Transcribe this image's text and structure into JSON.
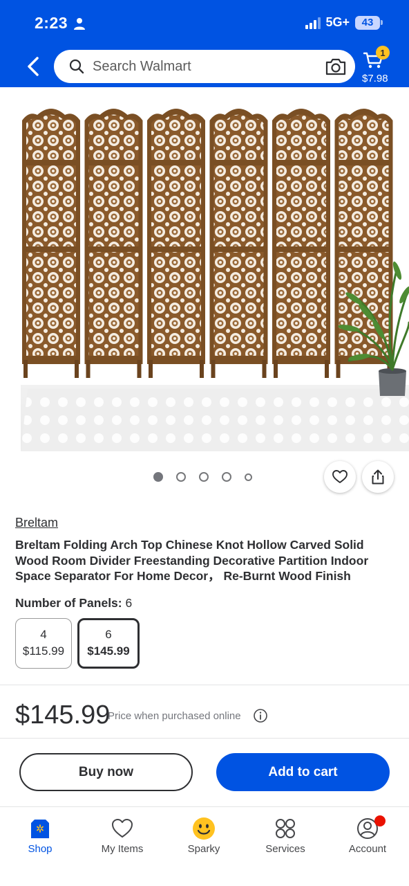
{
  "status_bar": {
    "time": "2:23",
    "network": "5G+",
    "battery": "43"
  },
  "header": {
    "search_placeholder": "Search Walmart",
    "cart_count": "1",
    "cart_total": "$7.98",
    "brand_color": "#0053e2"
  },
  "carousel": {
    "total_images": 5,
    "active_index": 0
  },
  "product": {
    "brand": "Breltam",
    "title": "Breltam Folding Arch Top Chinese Knot Hollow Carved Solid Wood Room Divider Freestanding Decorative Partition Indoor Space Separator For Home Decor，  Re-Burnt Wood Finish",
    "panels_label": "Number of Panels:",
    "panels_value": "6",
    "options": [
      {
        "panels": "4",
        "price": "$115.99"
      },
      {
        "panels": "6",
        "price": "$145.99"
      }
    ],
    "price": "$145.99",
    "price_note": "Price when purchased online"
  },
  "actions": {
    "buy_now": "Buy now",
    "add_to_cart": "Add to cart"
  },
  "bottom_nav": [
    {
      "label": "Shop",
      "icon": "shop-icon",
      "active": true
    },
    {
      "label": "My Items",
      "icon": "heart-icon"
    },
    {
      "label": "Sparky",
      "icon": "sparky-icon"
    },
    {
      "label": "Services",
      "icon": "services-icon"
    },
    {
      "label": "Account",
      "icon": "account-icon"
    }
  ]
}
